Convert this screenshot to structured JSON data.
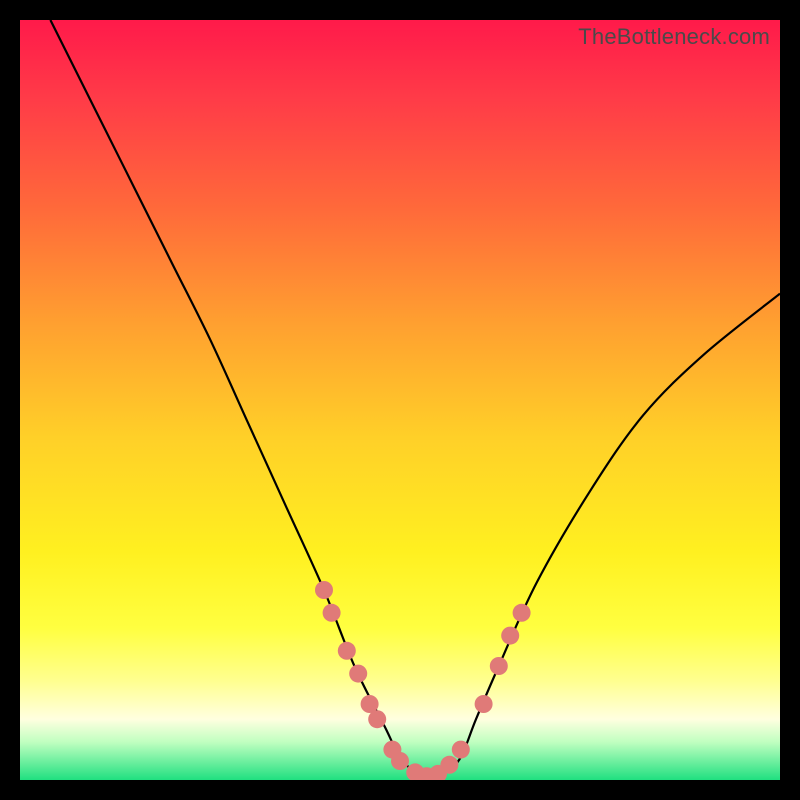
{
  "watermark": "TheBottleneck.com",
  "chart_data": {
    "type": "line",
    "title": "",
    "xlabel": "",
    "ylabel": "",
    "xlim": [
      0,
      100
    ],
    "ylim": [
      0,
      100
    ],
    "grid": false,
    "legend": false,
    "series": [
      {
        "name": "curve",
        "color": "#000000",
        "x": [
          4,
          10,
          15,
          20,
          25,
          30,
          35,
          40,
          44,
          48,
          50,
          52,
          54,
          56,
          58,
          60,
          63,
          68,
          75,
          82,
          90,
          100
        ],
        "y": [
          100,
          88,
          78,
          68,
          58,
          47,
          36,
          25,
          15,
          7,
          3,
          1,
          0,
          1,
          3,
          8,
          15,
          26,
          38,
          48,
          56,
          64
        ]
      }
    ],
    "markers": {
      "comment": "salmon bead clusters on the curve near the bottom",
      "color": "#e07a78",
      "radius_px": 9,
      "points_xy": [
        [
          40,
          25
        ],
        [
          41,
          22
        ],
        [
          43,
          17
        ],
        [
          44.5,
          14
        ],
        [
          46,
          10
        ],
        [
          47,
          8
        ],
        [
          49,
          4
        ],
        [
          50,
          2.5
        ],
        [
          52,
          1
        ],
        [
          53.5,
          0.5
        ],
        [
          55,
          0.8
        ],
        [
          56.5,
          2
        ],
        [
          58,
          4
        ],
        [
          61,
          10
        ],
        [
          63,
          15
        ],
        [
          64.5,
          19
        ],
        [
          66,
          22
        ]
      ]
    },
    "gradient_stops": [
      {
        "pos": 0.0,
        "color": "#ff1a4a"
      },
      {
        "pos": 0.25,
        "color": "#ff6a3a"
      },
      {
        "pos": 0.55,
        "color": "#ffd028"
      },
      {
        "pos": 0.8,
        "color": "#ffff40"
      },
      {
        "pos": 0.92,
        "color": "#ffffe0"
      },
      {
        "pos": 1.0,
        "color": "#20e080"
      }
    ]
  }
}
